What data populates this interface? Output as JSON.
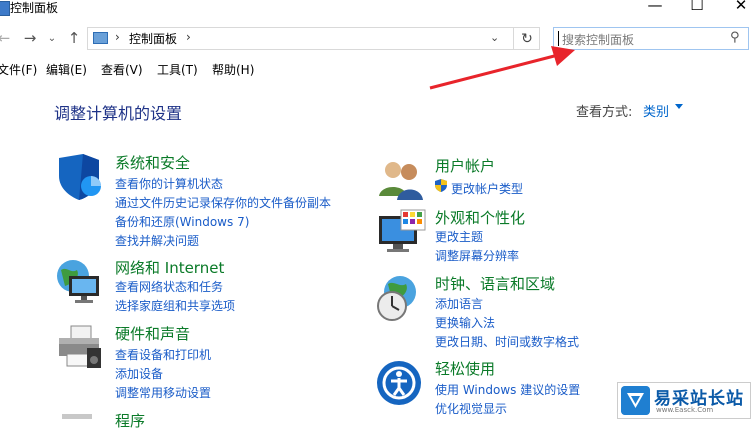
{
  "window": {
    "title": "控制面板",
    "minimize_glyph": "—",
    "maximize_glyph": "☐",
    "close_glyph": "✕"
  },
  "nav": {
    "back_glyph": "←",
    "forward_glyph": "→",
    "recent_glyph": "⌄",
    "up_glyph": "↑"
  },
  "address": {
    "sep1": "›",
    "path": "控制面板",
    "sep2": "›",
    "dropdown_glyph": "⌄",
    "refresh_glyph": "↻"
  },
  "search": {
    "placeholder": "搜索控制面板",
    "icon_glyph": "⚲"
  },
  "menu": [
    "文件(F)",
    "编辑(E)",
    "查看(V)",
    "工具(T)",
    "帮助(H)"
  ],
  "heading": "调整计算机的设置",
  "view_by": {
    "label": "查看方式:",
    "value": "类别"
  },
  "categories_left": [
    {
      "title": "系统和安全",
      "icon": "shield-icon",
      "links": [
        "查看你的计算机状态",
        "通过文件历史记录保存你的文件备份副本",
        "备份和还原(Windows 7)",
        "查找并解决问题"
      ]
    },
    {
      "title": "网络和 Internet",
      "icon": "network-globe-icon",
      "links": [
        "查看网络状态和任务",
        "选择家庭组和共享选项"
      ]
    },
    {
      "title": "硬件和声音",
      "icon": "printer-icon",
      "links": [
        "查看设备和打印机",
        "添加设备",
        "调整常用移动设置"
      ]
    },
    {
      "title": "程序",
      "icon": "programs-icon",
      "links": []
    }
  ],
  "categories_right": [
    {
      "title": "用户帐户",
      "icon": "users-icon",
      "links": [
        "更改帐户类型"
      ]
    },
    {
      "title": "外观和个性化",
      "icon": "monitor-palette-icon",
      "links": [
        "更改主题",
        "调整屏幕分辨率"
      ]
    },
    {
      "title": "时钟、语言和区域",
      "icon": "clock-globe-icon",
      "links": [
        "添加语言",
        "更换输入法",
        "更改日期、时间或数字格式"
      ]
    },
    {
      "title": "轻松使用",
      "icon": "ease-of-access-icon",
      "links": [
        "使用 Windows 建议的设置",
        "优化视觉显示"
      ]
    }
  ],
  "watermark": {
    "text": "易采站长站",
    "url": "www.Easck.Com"
  },
  "colors": {
    "heading": "#1e3287",
    "category_title": "#0a7a28",
    "link": "#1a5cc8",
    "arrow": "#e8242b"
  }
}
